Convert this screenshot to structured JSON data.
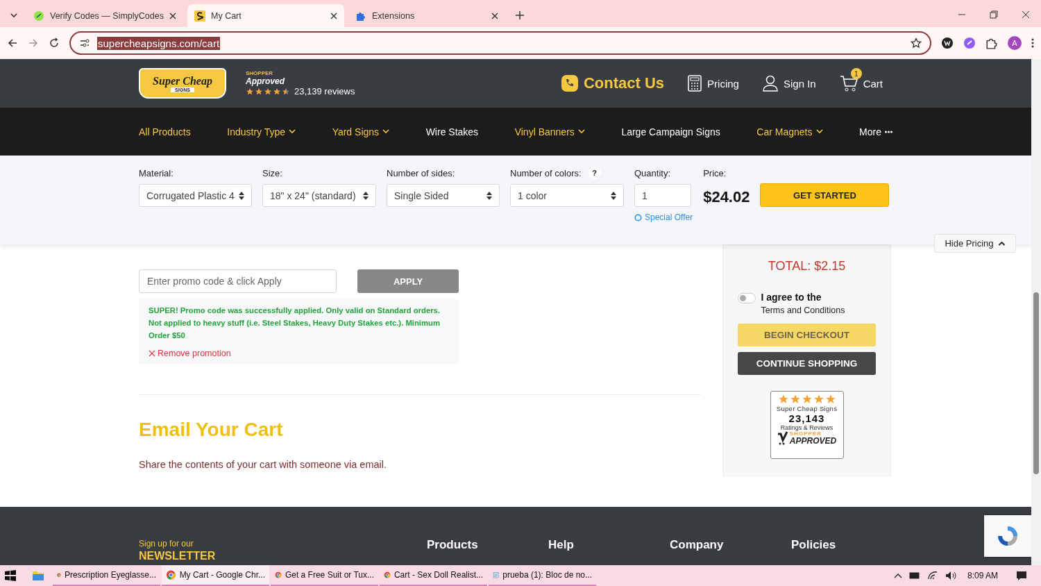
{
  "browser": {
    "tabs": [
      {
        "title": "Verify Codes — SimplyCodes",
        "selected": false,
        "kind": "simply"
      },
      {
        "title": "My Cart",
        "selected": true,
        "kind": "site"
      },
      {
        "title": "Extensions",
        "selected": false,
        "kind": "puzzle"
      }
    ],
    "url": "supercheapsigns.com/cart",
    "profile": "A"
  },
  "header": {
    "logo_top": "Super Cheap",
    "logo_bottom": "SIGNS",
    "approved_small": "SHOPPER",
    "approved": "Approved",
    "stars": 4.5,
    "reviews": "23,139 reviews",
    "contact": "Contact Us",
    "pricing": "Pricing",
    "sign_in": "Sign In",
    "cart": "Cart",
    "cart_count": "1"
  },
  "nav": [
    {
      "label": "All Products",
      "highlighted": true,
      "kind": "link"
    },
    {
      "label": "Industry Type",
      "highlighted": true,
      "kind": "dropdown"
    },
    {
      "label": "Yard Signs",
      "highlighted": true,
      "kind": "dropdown"
    },
    {
      "label": "Wire Stakes",
      "highlighted": false,
      "kind": "link"
    },
    {
      "label": "Vinyl Banners",
      "highlighted": true,
      "kind": "dropdown"
    },
    {
      "label": "Large Campaign Signs",
      "highlighted": false,
      "kind": "link"
    },
    {
      "label": "Car Magnets",
      "highlighted": true,
      "kind": "dropdown"
    },
    {
      "label": "More",
      "highlighted": false,
      "kind": "more"
    }
  ],
  "pricing_bar": {
    "fields": [
      {
        "label": "Material:",
        "value": "Corrugated Plastic 4",
        "kind": "select"
      },
      {
        "label": "Size:",
        "value": "18\" x 24\" (standard)",
        "kind": "select"
      },
      {
        "label": "Number of sides:",
        "value": "Single Sided",
        "kind": "select"
      },
      {
        "label": "Number of colors:",
        "value": "1 color",
        "kind": "select",
        "help": "?"
      },
      {
        "label": "Quantity:",
        "value": "1",
        "kind": "input",
        "link": "Special Offer"
      }
    ],
    "price_label": "Price:",
    "price": "$24.02",
    "button": "GET STARTED",
    "hide": "Hide Pricing"
  },
  "promo": {
    "placeholder": "Enter promo code & click Apply",
    "apply": "APPLY",
    "message": "SUPER! Promo code was successfully applied. Only valid on Standard orders. Not applied to heavy stuff (i.e. Steel Stakes, Heavy Duty Stakes etc.). Minimum Order $50",
    "remove": "Remove promotion"
  },
  "email": {
    "heading": "Email Your Cart",
    "text": "Share the contents of your cart with someone via email."
  },
  "summary": {
    "total": "TOTAL: $2.15",
    "agree_on": false,
    "agree": "I agree to the",
    "terms": "Terms and Conditions",
    "checkout": "BEGIN CHECKOUT",
    "checkout_disabled": true,
    "continue": "CONTINUE SHOPPING",
    "badge": {
      "stars": 5,
      "name": "Super Cheap Signs",
      "count": "23,143",
      "caption": "Ratings & Reviews",
      "small": "SHOPPER",
      "big": "APPROVED"
    }
  },
  "footer": {
    "newsletter_small": "Sign up for our",
    "newsletter": "NEWSLETTER",
    "columns": [
      "Products",
      "Help",
      "Company",
      "Policies"
    ]
  },
  "taskbar": {
    "apps": [
      {
        "title": "Prescription Eyeglasse...",
        "selected": false,
        "kind": "chrome"
      },
      {
        "title": "My Cart - Google Chr...",
        "selected": true,
        "kind": "chrome"
      },
      {
        "title": "Get a Free Suit or Tux...",
        "selected": false,
        "kind": "chrome"
      },
      {
        "title": "Cart - Sex Doll Realist...",
        "selected": false,
        "kind": "chrome"
      },
      {
        "title": "prueba (1): Bloc de no...",
        "selected": false,
        "kind": "notepad"
      }
    ],
    "time": "8:09 AM"
  }
}
